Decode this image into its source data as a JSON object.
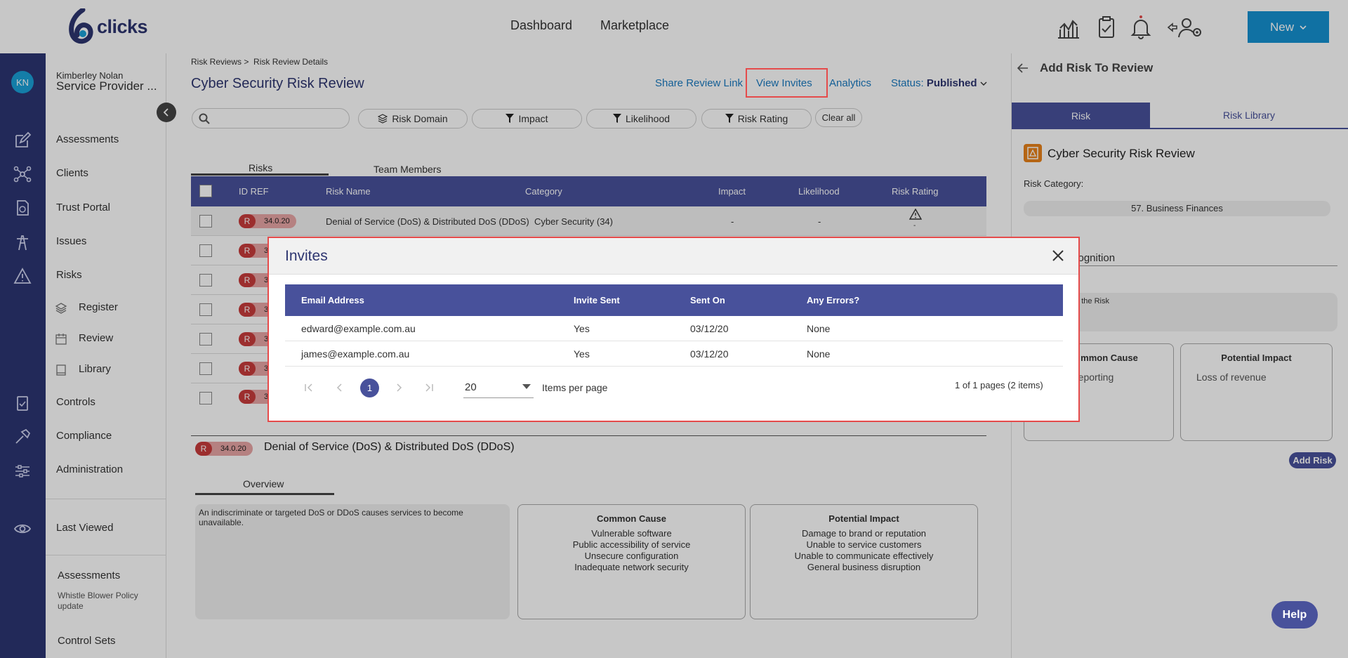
{
  "app": {
    "logo_text": "clicks"
  },
  "topnav": {
    "dashboard": "Dashboard",
    "marketplace": "Marketplace",
    "new_label": "New"
  },
  "user": {
    "initials": "KN",
    "name": "Kimberley Nolan",
    "org": "Service Provider ..."
  },
  "sidebar": {
    "assessments": "Assessments",
    "clients": "Clients",
    "trust_portal": "Trust Portal",
    "issues": "Issues",
    "risks": "Risks",
    "register": "Register",
    "review": "Review",
    "library": "Library",
    "controls": "Controls",
    "compliance": "Compliance",
    "administration": "Administration",
    "last_viewed": "Last Viewed",
    "recent_assessments": "Assessments",
    "recent_assessment_item": "Whistle Blower Policy update",
    "control_sets": "Control Sets"
  },
  "main": {
    "breadcrumb_1": "Risk Reviews >",
    "breadcrumb_2": "Risk Review Details",
    "title": "Cyber Security Risk Review",
    "share_link": "Share Review Link",
    "view_invites": "View Invites",
    "analytics": "Analytics",
    "status_label": "Status:",
    "status_value": "Published",
    "filters": {
      "risk_domain": "Risk Domain",
      "impact": "Impact",
      "likelihood": "Likelihood",
      "risk_rating": "Risk Rating",
      "clear_all": "Clear all"
    },
    "tabs": {
      "risks": "Risks",
      "team_members": "Team Members"
    },
    "columns": {
      "id_ref": "ID REF",
      "risk_name": "Risk Name",
      "category": "Category",
      "impact": "Impact",
      "likelihood": "Likelihood",
      "risk_rating": "Risk Rating"
    },
    "row1": {
      "badge_r": "R",
      "badge_id": "34.0.20",
      "name": "Denial of Service (DoS) & Distributed DoS (DDoS)",
      "category": "Cyber Security (34)",
      "impact": "-",
      "likelihood": "-",
      "rating": "-"
    },
    "row_badge_partial": "3",
    "detail": {
      "badge_r": "R",
      "badge_id": "34.0.20",
      "title": "Denial of Service (DoS) & Distributed DoS (DDoS)",
      "tab": "Overview",
      "description": "An indiscriminate or targeted DoS or DDoS causes services to become unavailable.",
      "common_cause_title": "Common Cause",
      "common_causes": [
        "Vulnerable software",
        "Public accessibility of service",
        "Unsecure configuration",
        "Inadequate network security"
      ],
      "potential_impact_title": "Potential Impact",
      "potential_impacts": [
        "Damage to brand or reputation",
        "Unable to service customers",
        "Unable to communicate effectively",
        "General business disruption"
      ]
    }
  },
  "right_panel": {
    "title": "Add Risk To Review",
    "tab_risk": "Risk",
    "tab_library": "Risk Library",
    "review_name": "Cyber Security Risk Review",
    "risk_category_label": "Risk Category:",
    "risk_category_value": "57. Business Finances",
    "title_field_value": "cognition",
    "description_hint": "of the Risk",
    "common_cause_title": "mmon Cause",
    "common_cause_value": "reporting",
    "potential_impact_title": "Potential Impact",
    "potential_impact_value": "Loss of revenue",
    "add_risk": "Add Risk"
  },
  "modal": {
    "title": "Invites",
    "columns": {
      "email": "Email Address",
      "invite_sent": "Invite Sent",
      "sent_on": "Sent On",
      "any_errors": "Any Errors?"
    },
    "rows": [
      {
        "email": "edward@example.com.au",
        "invite_sent": "Yes",
        "sent_on": "03/12/20",
        "errors": "None"
      },
      {
        "email": "james@example.com.au",
        "invite_sent": "Yes",
        "sent_on": "03/12/20",
        "errors": "None"
      }
    ],
    "pagination": {
      "current_page": "1",
      "per_page": "20",
      "per_page_label": "Items per page",
      "summary": "1 of 1 pages (2 items)"
    }
  },
  "help": {
    "label": "Help"
  },
  "colors": {
    "brand": "#2d3570",
    "accent": "#1591d1",
    "table_header": "#48519b",
    "highlight": "#e54b4b",
    "badge_red": "#c83b3b"
  },
  "icons": [
    "analytics-icon",
    "clipboard-check-icon",
    "bell-icon",
    "user-settings-icon",
    "edit-icon",
    "network-icon",
    "document-icon",
    "tower-icon",
    "warning-icon",
    "layers-icon",
    "calendar-icon",
    "book-icon",
    "checklist-icon",
    "hammer-icon",
    "sliders-icon",
    "eye-icon",
    "search-icon",
    "filter-icon",
    "close-icon",
    "back-arrow-icon"
  ]
}
